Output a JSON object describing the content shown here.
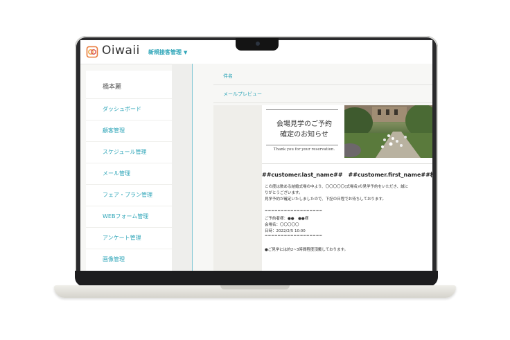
{
  "header": {
    "brand": "Oiwaii",
    "breadcrumb": "新規接客管理",
    "breadcrumb_caret": "▼",
    "logo_icon": "oiwaii-logo-icon"
  },
  "sidebar": {
    "title": "橋本麗",
    "items": [
      {
        "label": "ダッシュボード"
      },
      {
        "label": "顧客管理"
      },
      {
        "label": "スケジュール管理"
      },
      {
        "label": "メール管理"
      },
      {
        "label": "フェア・プラン管理"
      },
      {
        "label": "WEBフォーム管理"
      },
      {
        "label": "アンケート管理"
      },
      {
        "label": "画像管理"
      }
    ]
  },
  "form": {
    "subject_label": "件名",
    "preview_label": "メールプレビュー"
  },
  "mail": {
    "title_line1": "会場見学のご予約",
    "title_line2": "確定のお知らせ",
    "subtitle": "Thank you for your reservation.",
    "recipient": "##customer.last_name##　##customer.first_name##様",
    "body_line1": "この度は数ある結婚式場の中より、〇〇〇〇〇(式場名)の見学予約をいただき、誠に",
    "body_line2": "りがとうございます。",
    "body_line3": "見学予約が確定いたしましたので、下記の日程でお待ちしております。",
    "divider": "==================",
    "booker": "ご予約者様：●●　●●様",
    "venue": "会場名：〇〇〇〇〇",
    "datetime": "日時：2022/2/5 10:00",
    "note": "●ご見学には約2~3時間程度頂戴しております。"
  },
  "colors": {
    "accent": "#2ea5b8",
    "frame": "#2a2a2c",
    "laptop_body": "#e6e4de"
  }
}
